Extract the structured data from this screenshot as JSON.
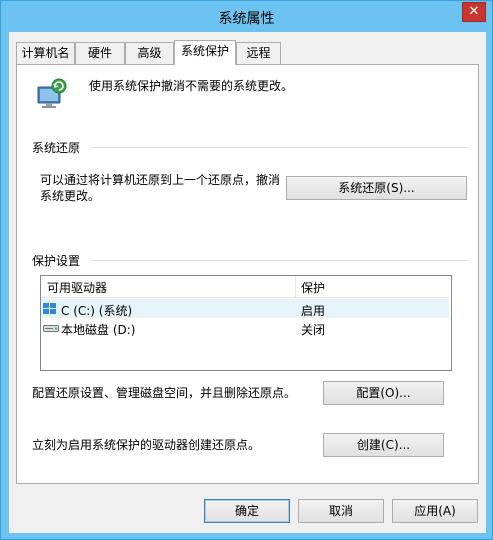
{
  "window": {
    "title": "系统属性",
    "close_glyph": "✕"
  },
  "tabs": [
    {
      "label": "计算机名",
      "active": false
    },
    {
      "label": "硬件",
      "active": false
    },
    {
      "label": "高级",
      "active": false
    },
    {
      "label": "系统保护",
      "active": true
    },
    {
      "label": "远程",
      "active": false
    }
  ],
  "intro": {
    "icon": "system-protection-icon",
    "text": "使用系统保护撤消不需要的系统更改。"
  },
  "restore": {
    "header": "系统还原",
    "description_line1": "可以通过将计算机还原到上一个还原点，撤消",
    "description_line2": "系统更改。",
    "button": "系统还原(S)..."
  },
  "protection": {
    "header": "保护设置",
    "columns": [
      "可用驱动器",
      "保护"
    ],
    "rows": [
      {
        "icon": "windows-drive-icon",
        "drive": "C (C:) (系统)",
        "status": "启用",
        "selected": true
      },
      {
        "icon": "local-disk-icon",
        "drive": "本地磁盘 (D:)",
        "status": "关闭",
        "selected": false
      }
    ],
    "configure_text": "配置还原设置、管理磁盘空间，并且删除还原点。",
    "configure_button": "配置(O)...",
    "create_text": "立刻为启用系统保护的驱动器创建还原点。",
    "create_button": "创建(C)..."
  },
  "footer": {
    "ok": "确定",
    "cancel": "取消",
    "apply": "应用(A)"
  },
  "colors": {
    "titlebar": "#6cc2f0",
    "close": "#c7372f",
    "selection": "#e5f3fb"
  }
}
